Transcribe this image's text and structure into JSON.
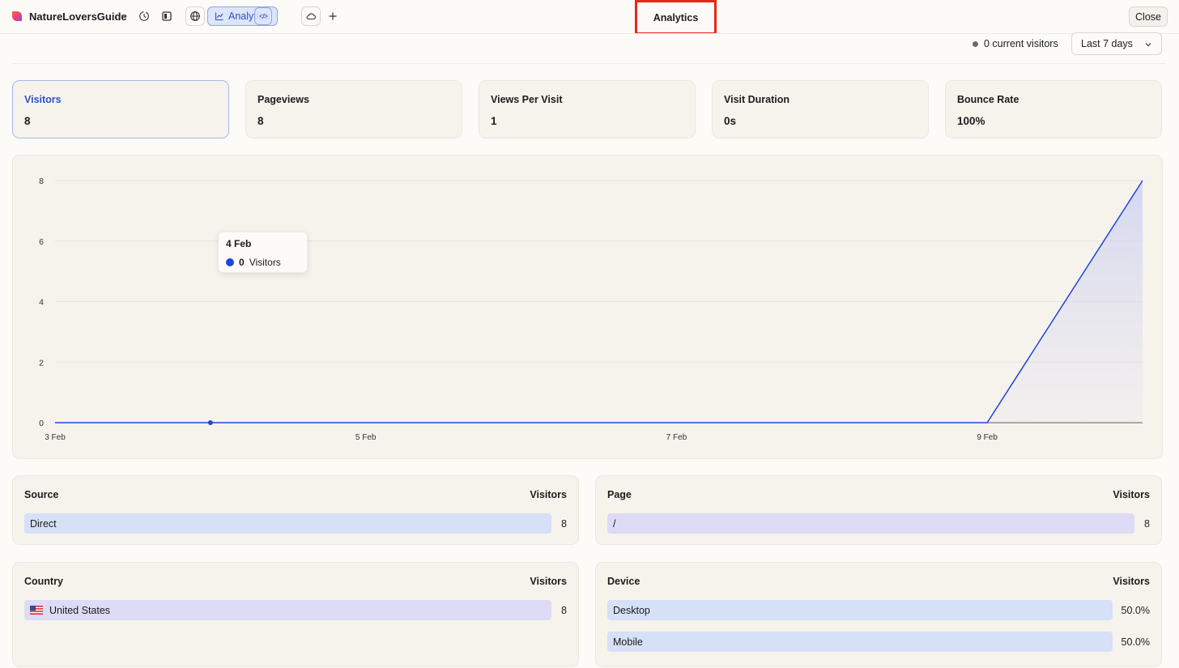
{
  "topbar": {
    "project_name": "NatureLoversGuide",
    "analytics_tab_label": "Analytics",
    "code_button_glyph": "</>",
    "center_title": "Analytics",
    "close_label": "Close",
    "icons": [
      "heart-logo-icon",
      "chevron-down-icon",
      "history-icon",
      "sidebar-toggle-icon",
      "globe-icon",
      "line-chart-icon",
      "code-icon",
      "cloud-icon",
      "plus-icon"
    ]
  },
  "header": {
    "current_visitors": "0 current visitors",
    "period": "Last 7 days"
  },
  "metrics": [
    {
      "label": "Visitors",
      "value": "8"
    },
    {
      "label": "Pageviews",
      "value": "8"
    },
    {
      "label": "Views Per Visit",
      "value": "1"
    },
    {
      "label": "Visit Duration",
      "value": "0s"
    },
    {
      "label": "Bounce Rate",
      "value": "100%"
    }
  ],
  "tooltip": {
    "date": "4 Feb",
    "value": "0",
    "series": "Visitors"
  },
  "chart_data": {
    "type": "area",
    "x": [
      "3 Feb",
      "4 Feb",
      "5 Feb",
      "6 Feb",
      "7 Feb",
      "8 Feb",
      "9 Feb",
      "10 Feb"
    ],
    "series": [
      {
        "name": "Visitors",
        "values": [
          0,
          0,
          0,
          0,
          0,
          0,
          0,
          8
        ]
      }
    ],
    "x_tick_labels": [
      "3 Feb",
      "5 Feb",
      "7 Feb",
      "9 Feb"
    ],
    "y_ticks": [
      0,
      2,
      4,
      6,
      8
    ],
    "ylim": [
      0,
      8
    ],
    "grid": true,
    "color": "#1f47d6",
    "highlighted_point": "4 Feb"
  },
  "sources": {
    "title": "Source",
    "metric": "Visitors",
    "rows": [
      {
        "label": "Direct",
        "value": "8",
        "color": "#d6e0f6"
      }
    ]
  },
  "pages": {
    "title": "Page",
    "metric": "Visitors",
    "rows": [
      {
        "label": "/",
        "value": "8",
        "color": "#dddbf5"
      }
    ]
  },
  "countries": {
    "title": "Country",
    "metric": "Visitors",
    "rows": [
      {
        "label": "United States",
        "value": "8",
        "color": "#dddbf5"
      }
    ]
  },
  "devices": {
    "title": "Device",
    "metric": "Visitors",
    "rows": [
      {
        "label": "Desktop",
        "value": "50.0%",
        "color": "#d6e0f6"
      },
      {
        "label": "Mobile",
        "value": "50.0%",
        "color": "#d6e0f6"
      }
    ]
  }
}
